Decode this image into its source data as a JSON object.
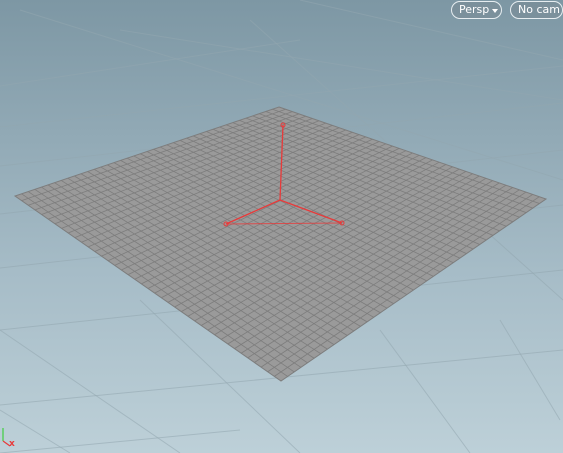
{
  "viewport": {
    "projection_menu": {
      "label": "Persp",
      "icon": "chevron-down-icon"
    },
    "camera_menu": {
      "label": "No cam",
      "icon": "chevron-down-icon"
    },
    "axis_indicator": {
      "x_label": "x"
    }
  },
  "colors": {
    "background_top": "#7d97a4",
    "background_bottom": "#bdd0d8",
    "ground_grid": "#93a7b0",
    "grid_plane": "#9a9a9a",
    "grid_lines": "#7d7d7d",
    "handle": "#e83a3a",
    "axis_x": "#e83a3a",
    "axis_y": "#3fcf3f"
  }
}
